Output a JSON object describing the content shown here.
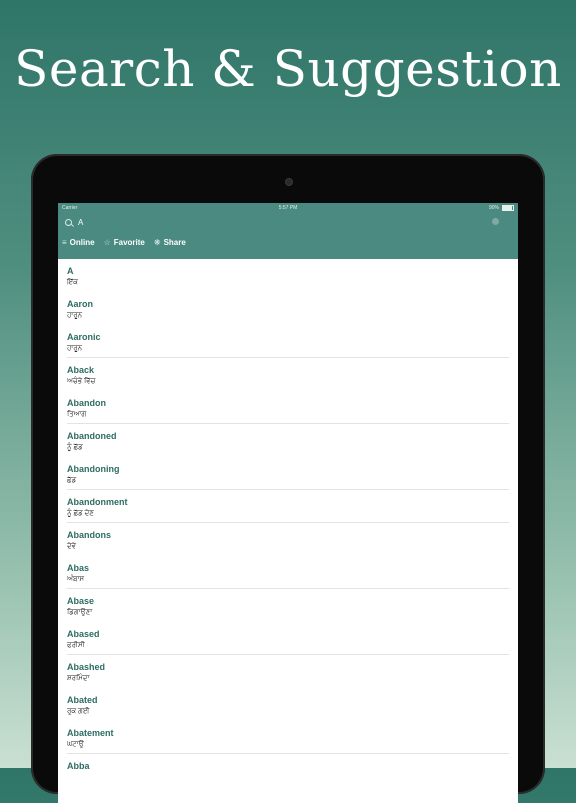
{
  "headline": "Search & Suggestion",
  "status_bar": {
    "carrier": "Carrier",
    "time": "5:57 PM",
    "battery": "90%"
  },
  "search": {
    "value": "A"
  },
  "toolbar": {
    "online": "Online",
    "favorite": "Favorite",
    "share": "Share"
  },
  "colors": {
    "accent": "#4a8a80",
    "word_text": "#2e6c64",
    "background_top": "#2f7568",
    "background_bottom": "#c9e0d2"
  },
  "results": [
    {
      "word": "A",
      "meaning": "ਇੱਕ"
    },
    {
      "word": "Aaron",
      "meaning": "ਹਾਰੂਨ"
    },
    {
      "word": "Aaronic",
      "meaning": "ਹਾਰੂਨ"
    },
    {
      "word": "Aback",
      "meaning": "ਅਚੰਭੇ ਵਿੱਚ"
    },
    {
      "word": "Abandon",
      "meaning": "ਤਿਆਗ"
    },
    {
      "word": "Abandoned",
      "meaning": "ਨੂੰ ਛੱਡ"
    },
    {
      "word": "Abandoning",
      "meaning": "ਛੱਡ"
    },
    {
      "word": "Abandonment",
      "meaning": "ਨੂੰ ਛੱਡ ਦੇਣ"
    },
    {
      "word": "Abandons",
      "meaning": "ਦੇਵੇ"
    },
    {
      "word": "Abas",
      "meaning": "ਅੰਬਾਸ"
    },
    {
      "word": "Abase",
      "meaning": "ਡਿਗਾਉਣਾ"
    },
    {
      "word": "Abased",
      "meaning": "ਫਰੀਸੀ"
    },
    {
      "word": "Abashed",
      "meaning": "ਸ਼ਰਮਿੰਦਾ"
    },
    {
      "word": "Abated",
      "meaning": "ਰੁਕ ਗਈ"
    },
    {
      "word": "Abatement",
      "meaning": "ਘਟਾਉ"
    },
    {
      "word": "Abba",
      "meaning": ""
    }
  ]
}
